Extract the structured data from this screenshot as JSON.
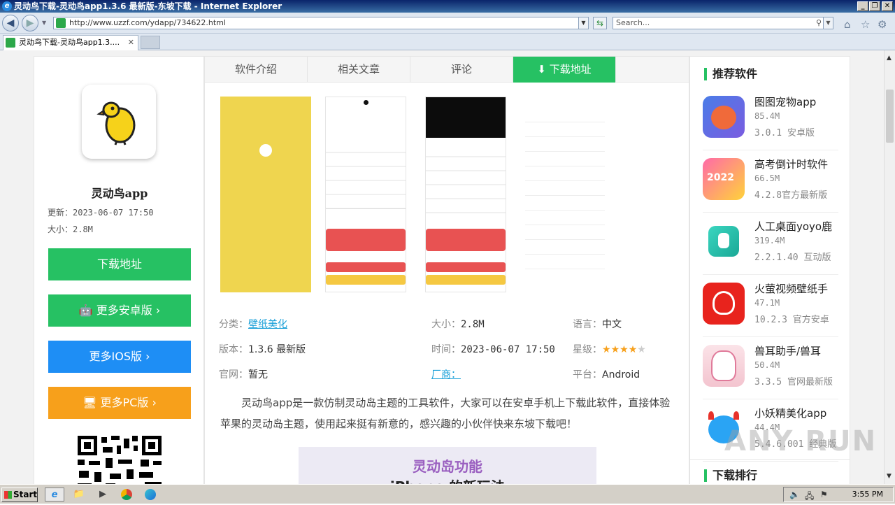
{
  "window": {
    "title": "灵动鸟下载-灵动鸟app1.3.6 最新版-东坡下载 - Internet Explorer",
    "buttons": [
      "_",
      "❐",
      "✕"
    ]
  },
  "address": {
    "url": "http://www.uzzf.com/ydapp/734622.html",
    "search_placeholder": "Search..."
  },
  "tab": {
    "title": "灵动鸟下载-灵动鸟app1.3....",
    "close": "✕"
  },
  "left": {
    "app_name": "灵动鸟app",
    "updated": "更新：2023-06-07 17:50",
    "size": "大小：2.8M",
    "btn_download": "下载地址",
    "btn_android": "更多安卓版",
    "btn_ios": "更多IOS版",
    "btn_pc": "更多PC版",
    "colors": {
      "green": "#26c163",
      "blue": "#1e8ef5",
      "orange": "#f7a01b"
    }
  },
  "tabs": [
    "软件介绍",
    "相关文章",
    "评论",
    "下载地址"
  ],
  "info": {
    "category_label": "分类：",
    "category": "壁纸美化",
    "size_label": "大小：",
    "size": "2.8M",
    "lang_label": "语言：",
    "lang": "中文",
    "version_label": "版本：",
    "version": "1.3.6 最新版",
    "time_label": "时间：",
    "time": "2023-06-07 17:50",
    "rating_label": "星级：",
    "rating": 4,
    "rating_max": 5,
    "site_label": "官网：",
    "site": "暂无",
    "vendor_label": "厂商：",
    "platform_label": "平台：",
    "platform": "Android"
  },
  "description": "灵动鸟app是一款仿制灵动岛主题的工具软件，大家可以在安卓手机上下载此软件，直接体验苹果的灵动岛主题，使用起来挺有新意的，感兴趣的小伙伴快来东坡下载吧！",
  "banner": {
    "line1": "灵动岛功能",
    "line2": "iPhone 的新玩法"
  },
  "right": {
    "heading": "推荐软件",
    "heading2": "下载排行",
    "items": [
      {
        "name": "图图宠物app",
        "size": "85.4M",
        "ver": "3.0.1 安卓版"
      },
      {
        "name": "高考倒计时软件",
        "size": "66.5M",
        "ver": "4.2.8官方最新版"
      },
      {
        "name": "人工桌面yoyo鹿",
        "size": "319.4M",
        "ver": "2.2.1.40 互动版"
      },
      {
        "name": "火萤视频壁纸手",
        "size": "47.1M",
        "ver": "10.2.3 官方安卓"
      },
      {
        "name": "兽耳助手/兽耳",
        "size": "50.4M",
        "ver": "3.3.5 官网最新版"
      },
      {
        "name": "小妖精美化app",
        "size": "44.4M",
        "ver": "5.4.6.001 经典版"
      }
    ]
  },
  "watermark": "ANY RUN",
  "taskbar": {
    "start": "Start",
    "clock": "3:55 PM"
  }
}
